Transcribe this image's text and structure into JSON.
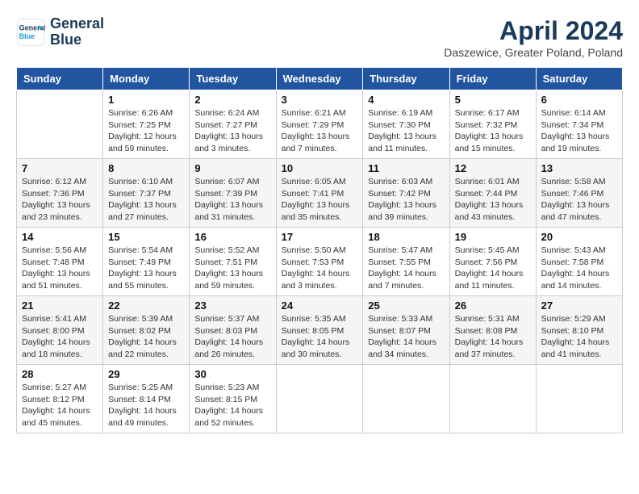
{
  "header": {
    "logo_line1": "General",
    "logo_line2": "Blue",
    "month_title": "April 2024",
    "location": "Daszewice, Greater Poland, Poland"
  },
  "days_of_week": [
    "Sunday",
    "Monday",
    "Tuesday",
    "Wednesday",
    "Thursday",
    "Friday",
    "Saturday"
  ],
  "weeks": [
    [
      {
        "day": "",
        "info": ""
      },
      {
        "day": "1",
        "info": "Sunrise: 6:26 AM\nSunset: 7:25 PM\nDaylight: 12 hours\nand 59 minutes."
      },
      {
        "day": "2",
        "info": "Sunrise: 6:24 AM\nSunset: 7:27 PM\nDaylight: 13 hours\nand 3 minutes."
      },
      {
        "day": "3",
        "info": "Sunrise: 6:21 AM\nSunset: 7:29 PM\nDaylight: 13 hours\nand 7 minutes."
      },
      {
        "day": "4",
        "info": "Sunrise: 6:19 AM\nSunset: 7:30 PM\nDaylight: 13 hours\nand 11 minutes."
      },
      {
        "day": "5",
        "info": "Sunrise: 6:17 AM\nSunset: 7:32 PM\nDaylight: 13 hours\nand 15 minutes."
      },
      {
        "day": "6",
        "info": "Sunrise: 6:14 AM\nSunset: 7:34 PM\nDaylight: 13 hours\nand 19 minutes."
      }
    ],
    [
      {
        "day": "7",
        "info": "Sunrise: 6:12 AM\nSunset: 7:36 PM\nDaylight: 13 hours\nand 23 minutes."
      },
      {
        "day": "8",
        "info": "Sunrise: 6:10 AM\nSunset: 7:37 PM\nDaylight: 13 hours\nand 27 minutes."
      },
      {
        "day": "9",
        "info": "Sunrise: 6:07 AM\nSunset: 7:39 PM\nDaylight: 13 hours\nand 31 minutes."
      },
      {
        "day": "10",
        "info": "Sunrise: 6:05 AM\nSunset: 7:41 PM\nDaylight: 13 hours\nand 35 minutes."
      },
      {
        "day": "11",
        "info": "Sunrise: 6:03 AM\nSunset: 7:42 PM\nDaylight: 13 hours\nand 39 minutes."
      },
      {
        "day": "12",
        "info": "Sunrise: 6:01 AM\nSunset: 7:44 PM\nDaylight: 13 hours\nand 43 minutes."
      },
      {
        "day": "13",
        "info": "Sunrise: 5:58 AM\nSunset: 7:46 PM\nDaylight: 13 hours\nand 47 minutes."
      }
    ],
    [
      {
        "day": "14",
        "info": "Sunrise: 5:56 AM\nSunset: 7:48 PM\nDaylight: 13 hours\nand 51 minutes."
      },
      {
        "day": "15",
        "info": "Sunrise: 5:54 AM\nSunset: 7:49 PM\nDaylight: 13 hours\nand 55 minutes."
      },
      {
        "day": "16",
        "info": "Sunrise: 5:52 AM\nSunset: 7:51 PM\nDaylight: 13 hours\nand 59 minutes."
      },
      {
        "day": "17",
        "info": "Sunrise: 5:50 AM\nSunset: 7:53 PM\nDaylight: 14 hours\nand 3 minutes."
      },
      {
        "day": "18",
        "info": "Sunrise: 5:47 AM\nSunset: 7:55 PM\nDaylight: 14 hours\nand 7 minutes."
      },
      {
        "day": "19",
        "info": "Sunrise: 5:45 AM\nSunset: 7:56 PM\nDaylight: 14 hours\nand 11 minutes."
      },
      {
        "day": "20",
        "info": "Sunrise: 5:43 AM\nSunset: 7:58 PM\nDaylight: 14 hours\nand 14 minutes."
      }
    ],
    [
      {
        "day": "21",
        "info": "Sunrise: 5:41 AM\nSunset: 8:00 PM\nDaylight: 14 hours\nand 18 minutes."
      },
      {
        "day": "22",
        "info": "Sunrise: 5:39 AM\nSunset: 8:02 PM\nDaylight: 14 hours\nand 22 minutes."
      },
      {
        "day": "23",
        "info": "Sunrise: 5:37 AM\nSunset: 8:03 PM\nDaylight: 14 hours\nand 26 minutes."
      },
      {
        "day": "24",
        "info": "Sunrise: 5:35 AM\nSunset: 8:05 PM\nDaylight: 14 hours\nand 30 minutes."
      },
      {
        "day": "25",
        "info": "Sunrise: 5:33 AM\nSunset: 8:07 PM\nDaylight: 14 hours\nand 34 minutes."
      },
      {
        "day": "26",
        "info": "Sunrise: 5:31 AM\nSunset: 8:08 PM\nDaylight: 14 hours\nand 37 minutes."
      },
      {
        "day": "27",
        "info": "Sunrise: 5:29 AM\nSunset: 8:10 PM\nDaylight: 14 hours\nand 41 minutes."
      }
    ],
    [
      {
        "day": "28",
        "info": "Sunrise: 5:27 AM\nSunset: 8:12 PM\nDaylight: 14 hours\nand 45 minutes."
      },
      {
        "day": "29",
        "info": "Sunrise: 5:25 AM\nSunset: 8:14 PM\nDaylight: 14 hours\nand 49 minutes."
      },
      {
        "day": "30",
        "info": "Sunrise: 5:23 AM\nSunset: 8:15 PM\nDaylight: 14 hours\nand 52 minutes."
      },
      {
        "day": "",
        "info": ""
      },
      {
        "day": "",
        "info": ""
      },
      {
        "day": "",
        "info": ""
      },
      {
        "day": "",
        "info": ""
      }
    ]
  ]
}
